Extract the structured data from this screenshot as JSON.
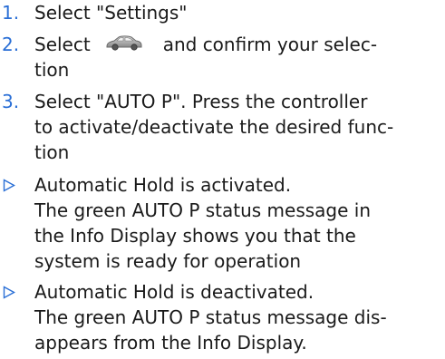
{
  "steps": [
    {
      "number": "1.",
      "lines": [
        "Select \"Settings\""
      ]
    },
    {
      "number": "2.",
      "line1_before": "Select",
      "icon": "car-icon",
      "line1_after": "and confirm your selec-",
      "line2": "tion"
    },
    {
      "number": "3.",
      "lines": [
        "Select \"AUTO P\". Press the controller",
        "to activate/deactivate the desired func-",
        "tion"
      ]
    }
  ],
  "results": [
    {
      "marker_icon": "triangle-right-icon",
      "lines": [
        "Automatic Hold is activated.",
        "The green AUTO P status message in",
        "the Info Display shows you that the",
        "system is ready for operation"
      ]
    },
    {
      "marker_icon": "triangle-right-icon",
      "lines": [
        "Automatic Hold is deactivated.",
        "The green AUTO P status message dis-",
        "appears from the Info Display."
      ]
    }
  ],
  "colors": {
    "accent": "#2a6fd6",
    "text": "#1a1a1a"
  }
}
